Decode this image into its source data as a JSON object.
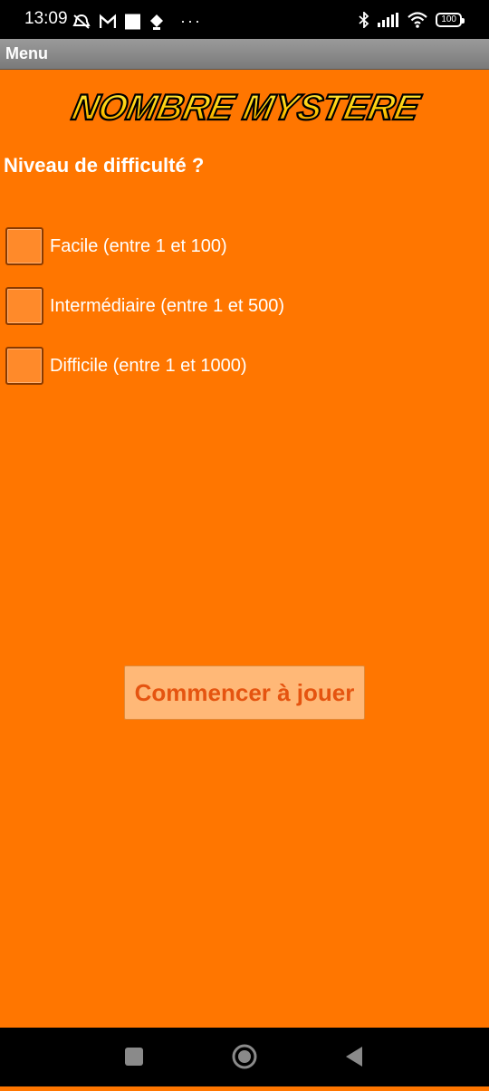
{
  "status_bar": {
    "time": "13:09",
    "battery": "100"
  },
  "app_bar": {
    "title": "Menu"
  },
  "logo_text": "NOMBRE MYSTERE",
  "question": "Niveau de difficulté ?",
  "options": [
    {
      "label": "Facile (entre 1 et 100)",
      "checked": false
    },
    {
      "label": "Intermédiaire (entre 1 et 500)",
      "checked": false
    },
    {
      "label": "Difficile (entre 1 et 1000)",
      "checked": false
    }
  ],
  "play_button": {
    "label": "Commencer à jouer"
  },
  "colors": {
    "background": "#ff7600",
    "button_bg": "#ffb877",
    "button_text": "#e55410",
    "logo_fill": "#ffd21f"
  },
  "nav": {
    "icons": [
      "recent-apps-icon",
      "home-icon",
      "back-icon"
    ]
  }
}
